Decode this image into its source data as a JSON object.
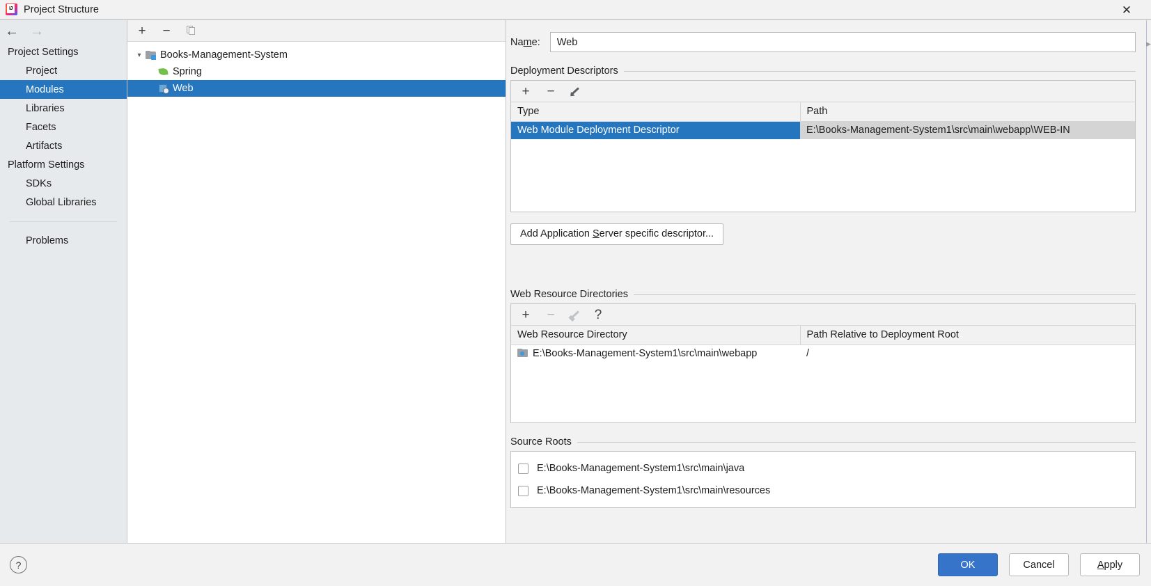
{
  "window": {
    "title": "Project Structure",
    "logo_icon": "intellij-idea-logo",
    "close_icon": "close-icon"
  },
  "nav": {
    "back_icon": "arrow-left-icon",
    "forward_icon": "arrow-right-icon"
  },
  "sidebar": {
    "groups": [
      {
        "label": "Project Settings",
        "items": [
          {
            "label": "Project",
            "selected": false
          },
          {
            "label": "Modules",
            "selected": true
          },
          {
            "label": "Libraries",
            "selected": false
          },
          {
            "label": "Facets",
            "selected": false
          },
          {
            "label": "Artifacts",
            "selected": false
          }
        ]
      },
      {
        "label": "Platform Settings",
        "items": [
          {
            "label": "SDKs",
            "selected": false
          },
          {
            "label": "Global Libraries",
            "selected": false
          }
        ]
      }
    ],
    "extra": {
      "label": "Problems"
    }
  },
  "tree_panel": {
    "toolbar": {
      "add_icon": "plus-icon",
      "remove_icon": "minus-icon",
      "copy_icon": "copy-icon",
      "add_label": "+",
      "remove_label": "−"
    },
    "nodes": [
      {
        "label": "Books-Management-System",
        "icon": "module-folder-icon",
        "expanded": true,
        "level": 0,
        "selected": false
      },
      {
        "label": "Spring",
        "icon": "spring-leaf-icon",
        "level": 1,
        "selected": false
      },
      {
        "label": "Web",
        "icon": "web-module-icon",
        "level": 1,
        "selected": true
      }
    ],
    "expand_chevron": "chevron-down-icon"
  },
  "detail": {
    "name_label_pre": "Na",
    "name_label_mnemonic": "m",
    "name_label_post": "e:",
    "name_value": "Web",
    "deployment_descriptors": {
      "title": "Deployment Descriptors",
      "toolbar": {
        "add_icon": "plus-icon",
        "remove_icon": "minus-icon",
        "edit_icon": "pencil-icon",
        "add_label": "+",
        "remove_label": "−"
      },
      "columns": [
        "Type",
        "Path"
      ],
      "rows": [
        {
          "type": "Web Module Deployment Descriptor",
          "path": "E:\\Books-Management-System1\\src\\main\\webapp\\WEB-IN",
          "selected": true
        }
      ],
      "add_descriptor_button": {
        "pre": "Add Application ",
        "mnemonic": "S",
        "post": "erver specific descriptor..."
      }
    },
    "web_resource_directories": {
      "title": "Web Resource Directories",
      "toolbar": {
        "add_icon": "plus-icon",
        "remove_icon": "minus-icon",
        "edit_icon": "pencil-icon",
        "help_icon": "question-mark-icon",
        "add_label": "+",
        "remove_label": "−",
        "help_label": "?"
      },
      "columns": [
        "Web Resource Directory",
        "Path Relative to Deployment Root"
      ],
      "rows": [
        {
          "directory": "E:\\Books-Management-System1\\src\\main\\webapp",
          "relative_path": "/",
          "icon": "directory-icon"
        }
      ]
    },
    "source_roots": {
      "title": "Source Roots",
      "rows": [
        {
          "path": "E:\\Books-Management-System1\\src\\main\\java",
          "checked": false
        },
        {
          "path": "E:\\Books-Management-System1\\src\\main\\resources",
          "checked": false
        }
      ]
    }
  },
  "footer": {
    "help_label": "?",
    "help_icon": "help-icon",
    "ok_label": "OK",
    "cancel_label": "Cancel",
    "apply_pre": "",
    "apply_mnemonic": "A",
    "apply_post": "pply"
  },
  "colors": {
    "selection_blue": "#2675bf",
    "primary_button": "#3574c8",
    "sidebar_bg": "#e6eaed",
    "dialog_bg": "#f2f2f2"
  }
}
